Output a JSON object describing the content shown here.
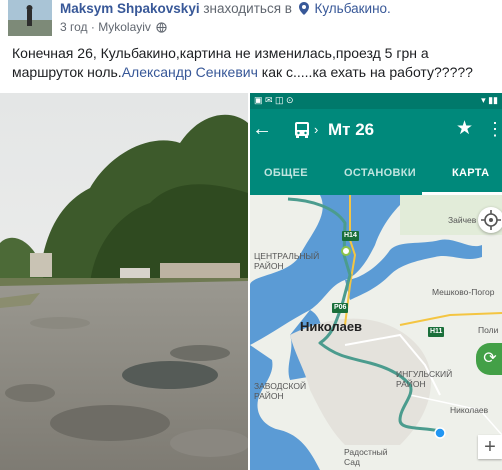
{
  "post": {
    "author": "Maksym Shpakovskyi",
    "verb": "знаходиться в",
    "place": "Кульбакино.",
    "time": "3 год",
    "location": "Mykolayiv",
    "text_part1": "Конечная 26, Кульбакино,картина не изменилась,проезд 5 грн а маршруток ноль.",
    "mention": "Александр Сенкевич",
    "text_part2": " как с.....ка ехать на работу?????"
  },
  "phone": {
    "route_title": "Мт 26",
    "tabs": [
      {
        "label": "ОБЩЕЕ",
        "active": false
      },
      {
        "label": "ОСТАНОВКИ",
        "active": false
      },
      {
        "label": "КАРТА",
        "active": true
      }
    ],
    "map": {
      "city": "Николаев",
      "labels": {
        "central": "ЦЕНТРАЛЬНЫЙ\nРАЙОН",
        "zavodsky": "ЗАВОДСКОЙ\nРАЙОН",
        "ingulsky": "ИНГУЛЬСКИЙ\nРАЙОН",
        "zaichi": "Зайчев",
        "meshkovo": "Мешково-Погор",
        "poli": "Поли",
        "nikolaev_east": "Николаев",
        "radostny": "Радостный\nСад"
      },
      "road_shields": {
        "h14": "H14",
        "p06": "P06",
        "h11": "H11"
      }
    }
  },
  "colors": {
    "link": "#385898",
    "app_teal": "#00897b",
    "route_line": "#4b9c8e",
    "water": "#5b9bd5"
  },
  "icons": {
    "pin": "location-pin-icon",
    "globe": "globe-icon",
    "back": "arrow-left-icon",
    "bus": "bus-icon",
    "star": "star-icon",
    "more": "more-vertical-icon",
    "locate": "crosshair-icon",
    "refresh": "refresh-icon",
    "zoom": "plus-icon"
  }
}
